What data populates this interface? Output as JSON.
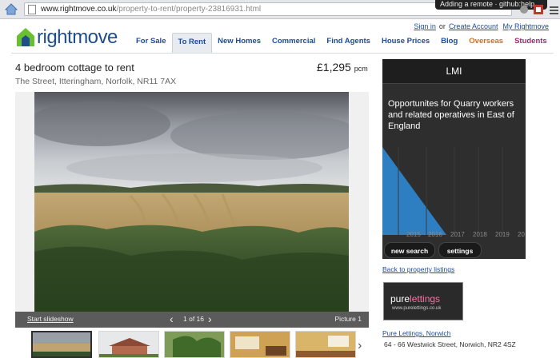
{
  "browser": {
    "url_host": "www.rightmove.co.uk",
    "url_path": "/property-to-rent/property-23816931.html",
    "tooltip": "Adding a remote · github:help"
  },
  "toplinks": {
    "sign_in": "Sign in",
    "or": "or",
    "create_account": "Create Account",
    "my_rightmove": "My Rightmove"
  },
  "logo": {
    "text": "rightmove"
  },
  "nav": [
    {
      "label": "For Sale"
    },
    {
      "label": "To Rent",
      "active": true
    },
    {
      "label": "New Homes"
    },
    {
      "label": "Commercial"
    },
    {
      "label": "Find Agents"
    },
    {
      "label": "House Prices"
    },
    {
      "label": "Blog"
    },
    {
      "label": "Overseas",
      "color": "#e06a10"
    },
    {
      "label": "Students",
      "color": "#9b2a6b"
    }
  ],
  "listing": {
    "title": "4 bedroom cottage to rent",
    "address": "The Street, Itteringham, Norfolk, NR11 7AX",
    "price": "£1,295",
    "price_unit": "pcm"
  },
  "gallery": {
    "slideshow": "Start slideshow",
    "counter": "1 of 16",
    "picture_label": "Picture 1",
    "current": 1,
    "total": 16,
    "thumb_count_visible": 5
  },
  "advert": {
    "title": "LMI",
    "text": "Opportunites for Quarry workers and related operatives in East of England",
    "years": [
      "2015",
      "2016",
      "2017",
      "2018",
      "2019",
      "20"
    ],
    "buttons": {
      "new_search": "new search",
      "settings": "settings"
    }
  },
  "agent": {
    "back_link": "Back to property listings",
    "logo_pure": "pure",
    "logo_lettings": "lettings",
    "logo_site": "www.purelettings.co.uk",
    "name": "Pure Lettings, Norwich",
    "address": "64 - 66 Westwick Street, Norwich, NR2 4SZ"
  },
  "colors": {
    "brand_blue": "#1f4e8c",
    "brand_green": "#6abf2e",
    "link_blue": "#1a4b9c"
  }
}
